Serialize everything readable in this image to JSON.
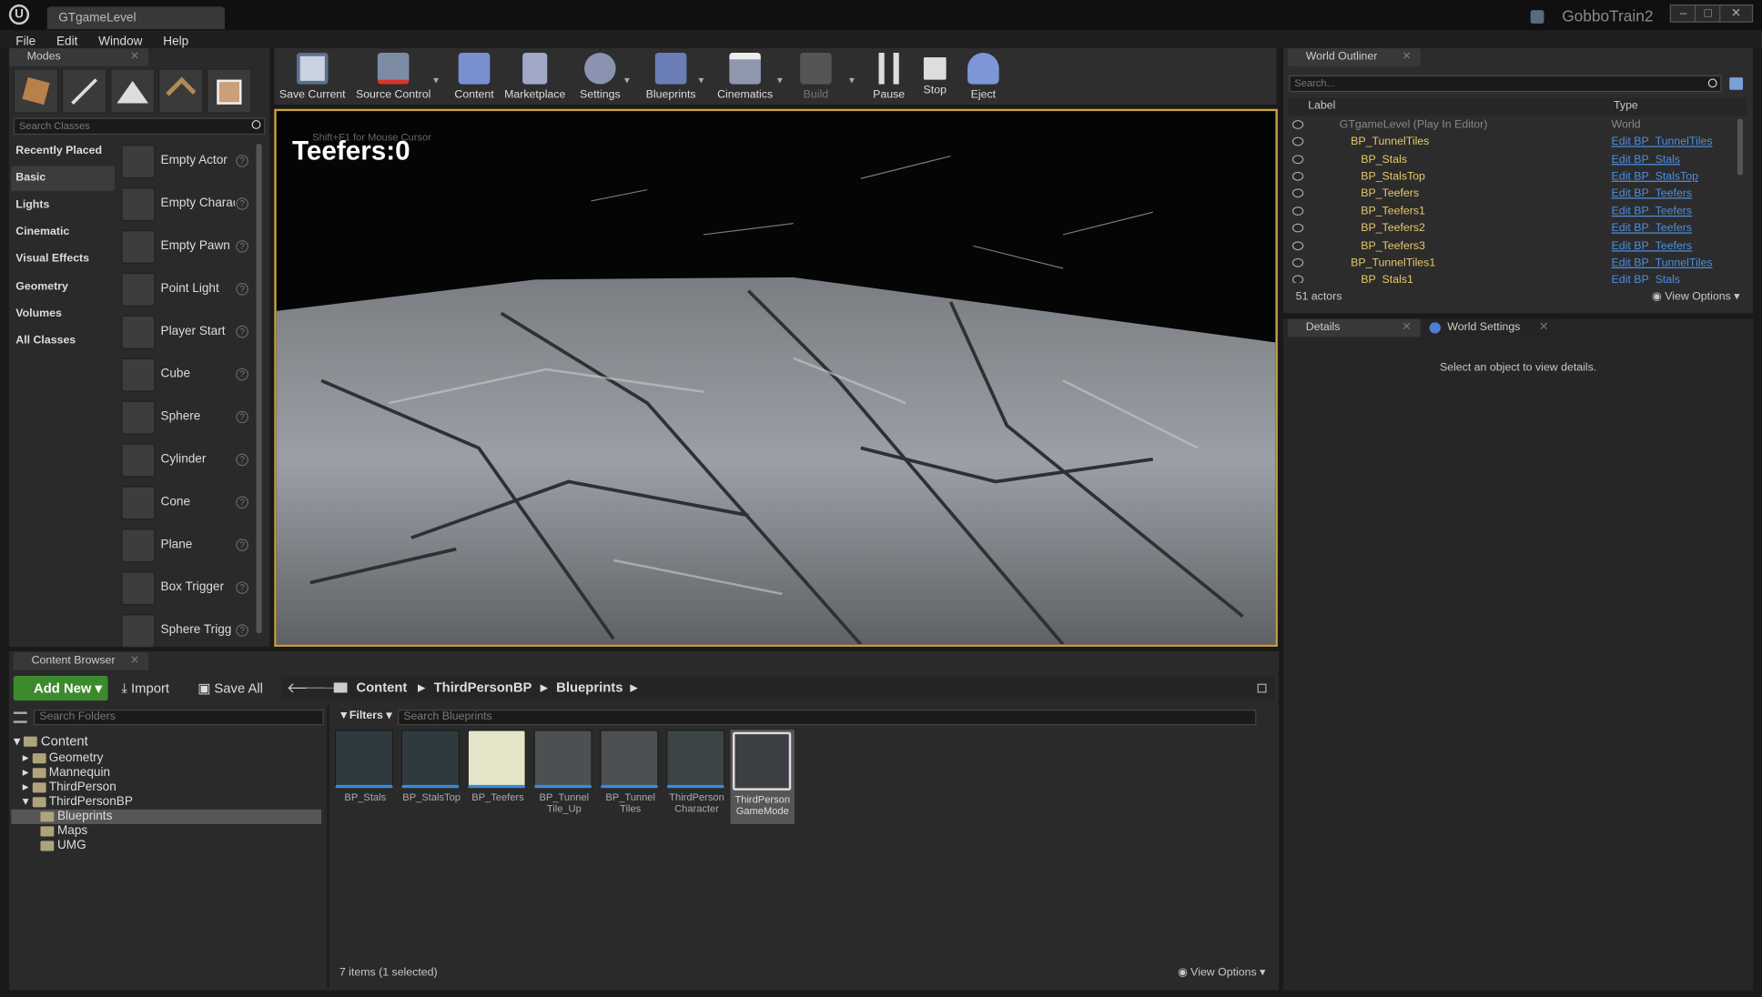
{
  "window": {
    "doc_tab": "GTgameLevel",
    "project": "GobboTrain2",
    "min": "–",
    "max": "□",
    "close": "✕"
  },
  "menu": [
    "File",
    "Edit",
    "Window",
    "Help"
  ],
  "modes": {
    "tab": "Modes",
    "search_placeholder": "Search Classes",
    "categories": [
      "Recently Placed",
      "Basic",
      "Lights",
      "Cinematic",
      "Visual Effects",
      "Geometry",
      "Volumes",
      "All Classes"
    ],
    "selected_category": "Basic",
    "items": [
      "Empty Actor",
      "Empty Charac",
      "Empty Pawn",
      "Point Light",
      "Player Start",
      "Cube",
      "Sphere",
      "Cylinder",
      "Cone",
      "Plane",
      "Box Trigger",
      "Sphere Trigg"
    ]
  },
  "toolbar": [
    "Save Current",
    "Source Control",
    "Content",
    "Marketplace",
    "Settings",
    "Blueprints",
    "Cinematics",
    "Build",
    "Pause",
    "Stop",
    "Eject"
  ],
  "viewport": {
    "hint": "Shift+F1 for Mouse Cursor",
    "score": "Teefers:0"
  },
  "outliner": {
    "tab": "World Outliner",
    "search_placeholder": "Search...",
    "col_label": "Label",
    "col_type": "Type",
    "rows": [
      {
        "label": "GTgameLevel (Play In Editor)",
        "type": "World"
      },
      {
        "label": "BP_TunnelTiles",
        "type": "Edit BP_TunnelTiles"
      },
      {
        "label": "BP_Stals",
        "type": "Edit BP_Stals"
      },
      {
        "label": "BP_StalsTop",
        "type": "Edit BP_StalsTop"
      },
      {
        "label": "BP_Teefers",
        "type": "Edit BP_Teefers"
      },
      {
        "label": "BP_Teefers1",
        "type": "Edit BP_Teefers"
      },
      {
        "label": "BP_Teefers2",
        "type": "Edit BP_Teefers"
      },
      {
        "label": "BP_Teefers3",
        "type": "Edit BP_Teefers"
      },
      {
        "label": "BP_TunnelTiles1",
        "type": "Edit BP_TunnelTiles"
      },
      {
        "label": "BP_Stals1",
        "type": "Edit BP_Stals"
      }
    ],
    "count": "51 actors",
    "view_options": "View Options"
  },
  "details": {
    "tab_details": "Details",
    "tab_world": "World Settings",
    "empty": "Select an object to view details."
  },
  "content_browser": {
    "tab": "Content Browser",
    "add_new": "Add New",
    "import": "Import",
    "save_all": "Save All",
    "path": [
      "Content",
      "ThirdPersonBP",
      "Blueprints"
    ],
    "folder_search": "Search Folders",
    "filters": "Filters",
    "bp_search": "Search Blueprints",
    "folders": [
      "Content",
      "Geometry",
      "Mannequin",
      "ThirdPerson",
      "ThirdPersonBP",
      "Blueprints",
      "Maps",
      "UMG"
    ],
    "assets": [
      "BP_Stals",
      "BP_StalsTop",
      "BP_Teefers",
      "BP_Tunnel Tile_Up",
      "BP_Tunnel Tiles",
      "ThirdPerson Character",
      "ThirdPerson GameMode"
    ],
    "status": "7 items (1 selected)",
    "view_options": "View Options"
  }
}
